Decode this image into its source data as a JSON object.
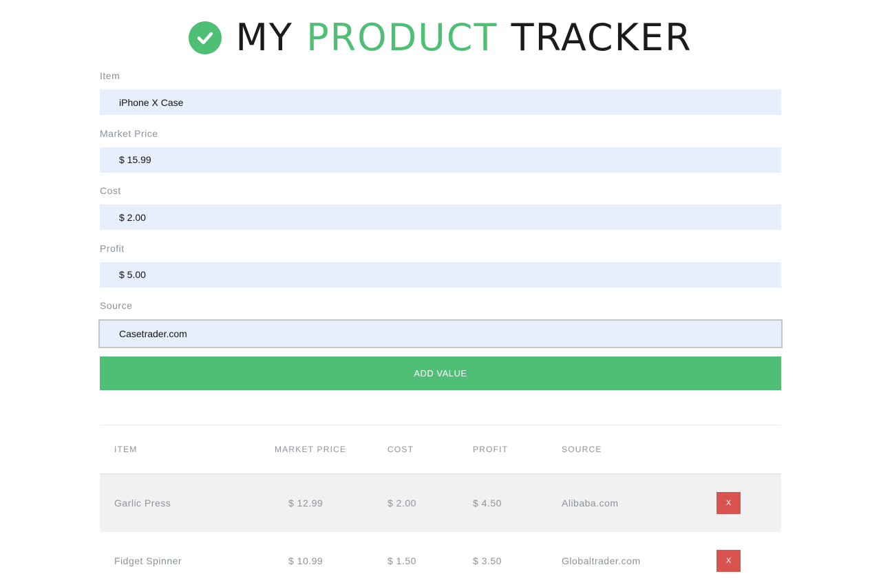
{
  "header": {
    "title_part1": "MY ",
    "title_accent": "PRODUCT",
    "title_part2": " TRACKER",
    "logo_icon": "check-circle-icon",
    "accent_color": "#4fbf75"
  },
  "form": {
    "fields": [
      {
        "label": "Item",
        "value": "iPhone X Case"
      },
      {
        "label": "Market Price",
        "value": "$ 15.99"
      },
      {
        "label": "Cost",
        "value": "$ 2.00"
      },
      {
        "label": "Profit",
        "value": "$ 5.00"
      },
      {
        "label": "Source",
        "value": "Casetrader.com"
      }
    ],
    "submit_label": "ADD VALUE"
  },
  "table": {
    "columns": [
      "ITEM",
      "MARKET PRICE",
      "COST",
      "PROFIT",
      "SOURCE"
    ],
    "rows": [
      {
        "item": "Garlic Press",
        "price": "$ 12.99",
        "cost": "$ 2.00",
        "profit": "$ 4.50",
        "source": "Alibaba.com",
        "delete_label": "X"
      },
      {
        "item": "Fidget Spinner",
        "price": "$ 10.99",
        "cost": "$ 1.50",
        "profit": "$ 3.50",
        "source": "Globaltrader.com",
        "delete_label": "X"
      }
    ],
    "delete_color": "#d9534f"
  }
}
